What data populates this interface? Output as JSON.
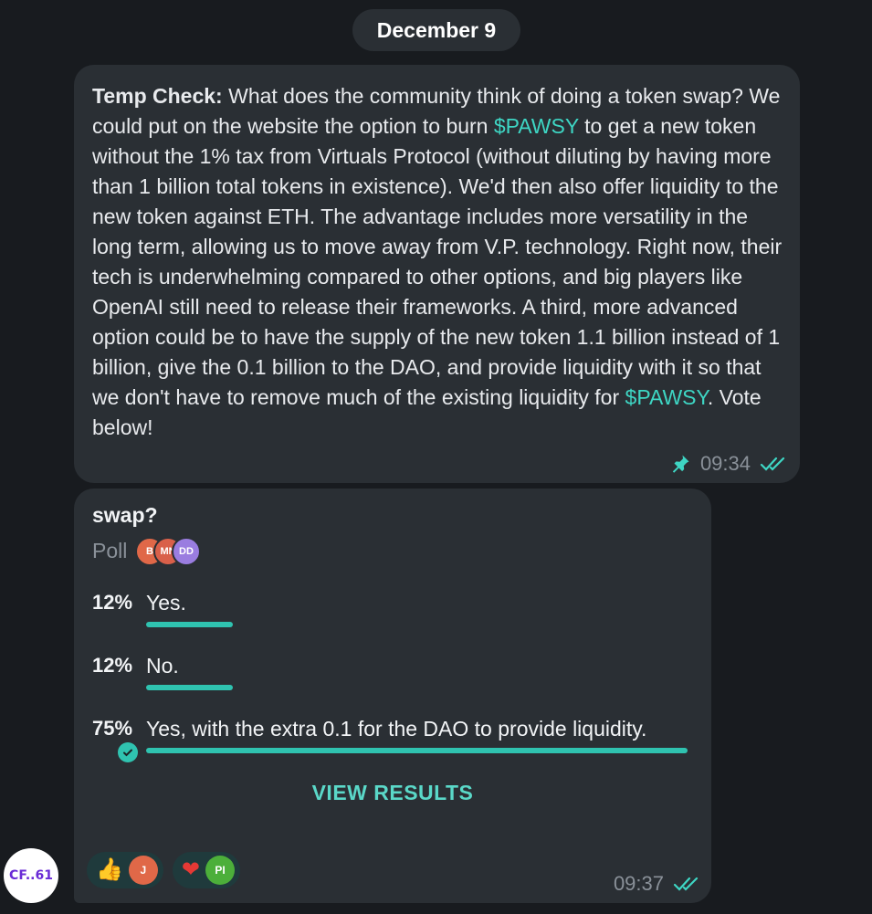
{
  "date_separator": "December 9",
  "message1": {
    "lead": "Temp Check:",
    "text_a": " What does the community think of doing a token swap? We could put on the website the option to burn ",
    "ticker_a": "$PAWSY",
    "text_b": " to get a new token without the 1% tax from Virtuals Protocol (without diluting by having more than 1 billion total tokens in existence). We'd then also offer liquidity to the new token against ETH. The advantage includes more versatility in the long term, allowing us to move away from V.P. technology. Right now, their tech is underwhelming compared to other options, and big players like OpenAI still need to release their frameworks. A third, more advanced option could be to have the supply of the new token 1.1 billion instead of 1 billion, give the 0.1 billion to the DAO, and provide liquidity with it so that we don't have to remove much of the existing liquidity for ",
    "ticker_b": "$PAWSY",
    "text_c": ". Vote below!",
    "time": "09:34",
    "pin_icon": "pin-icon",
    "read_icon": "double-check-icon"
  },
  "poll": {
    "question": "swap?",
    "label": "Poll",
    "voters": [
      "B",
      "MN",
      "DD"
    ],
    "options": [
      {
        "percent": "12%",
        "text": "Yes.",
        "fraction": 0.12
      },
      {
        "percent": "12%",
        "text": "No.",
        "fraction": 0.12
      },
      {
        "percent": "75%",
        "text": "Yes, with the extra 0.1 for the DAO to provide liquidity.",
        "fraction": 0.75,
        "chosen": true
      }
    ],
    "view_results": "VIEW RESULTS",
    "time": "09:37",
    "reactions": [
      {
        "emoji": "👍",
        "icon": "thumbs-up-icon",
        "avatar": "J"
      },
      {
        "emoji": "❤",
        "icon": "heart-icon",
        "avatar": "PI"
      }
    ]
  },
  "sender_avatar": "CF..61",
  "colors": {
    "background": "#181b1f",
    "bubble": "#2a2f34",
    "accent": "#3ed6c4",
    "bar": "#2fc3b0",
    "muted": "#8a9199"
  }
}
